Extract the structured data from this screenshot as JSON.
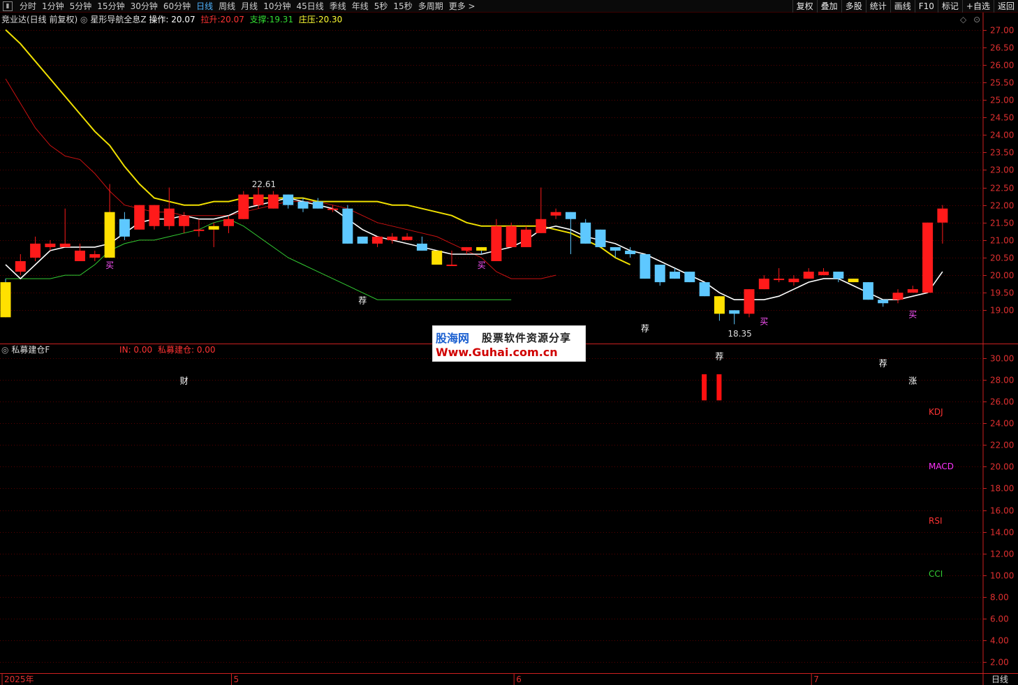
{
  "toolbar": {
    "periods": [
      {
        "label": "分时",
        "active": false
      },
      {
        "label": "1分钟",
        "active": false
      },
      {
        "label": "5分钟",
        "active": false
      },
      {
        "label": "15分钟",
        "active": false
      },
      {
        "label": "30分钟",
        "active": false
      },
      {
        "label": "60分钟",
        "active": false
      },
      {
        "label": "日线",
        "active": true
      },
      {
        "label": "周线",
        "active": false
      },
      {
        "label": "月线",
        "active": false
      },
      {
        "label": "10分钟",
        "active": false
      },
      {
        "label": "45日线",
        "active": false
      },
      {
        "label": "季线",
        "active": false
      },
      {
        "label": "年线",
        "active": false
      },
      {
        "label": "5秒",
        "active": false
      },
      {
        "label": "15秒",
        "active": false
      },
      {
        "label": "多周期",
        "active": false
      },
      {
        "label": "更多 >",
        "active": false
      }
    ],
    "right": [
      "复权",
      "叠加",
      "多股",
      "统计",
      "画线",
      "F10",
      "标记",
      "+自选",
      "返回"
    ]
  },
  "main_info": {
    "stock": "竞业达(日线 前复权)",
    "indicator": "星形导航全息Z",
    "op_label": "操作: 20.07",
    "pull_label": "拉升:",
    "pull_value": "20.07",
    "support_label": "支撑:",
    "support_value": "19.31",
    "press_label": "庄压:",
    "press_value": "20.30"
  },
  "sub_info": {
    "name": "私募建仓F",
    "in_label": "IN: 0.00",
    "pm_label": "私募建仓: 0.00"
  },
  "watermark": {
    "line1": "股海网",
    "line2": "股票软件资源分享",
    "line3": "Www.Guhai.com.cn"
  },
  "colors": {
    "up": "#ff1a1a",
    "down": "#5ec8ff",
    "ma_white": "#ffffff",
    "ma_yellow": "#f0e000",
    "ma_red": "#cc1111",
    "ma_green": "#33cc33",
    "grid": "#5a0000",
    "axis": "#cc2020"
  },
  "chart_data": [
    {
      "type": "candlestick",
      "y_ticks": [
        27.0,
        26.5,
        26.0,
        25.5,
        25.0,
        24.5,
        24.0,
        23.5,
        23.0,
        22.5,
        22.0,
        21.5,
        21.0,
        20.5,
        20.0,
        19.5,
        19.0
      ],
      "ylim": [
        18.05,
        27.45
      ],
      "x_labels": [
        {
          "label": "2025年",
          "index": 0
        },
        {
          "label": "5",
          "index": 15
        },
        {
          "label": "6",
          "index": 34
        },
        {
          "label": "7",
          "index": 54
        }
      ],
      "candles": [
        [
          19.8,
          18.8,
          19.9,
          18.8
        ],
        [
          20.1,
          20.4,
          20.6,
          20.0
        ],
        [
          20.5,
          20.9,
          21.1,
          20.4
        ],
        [
          20.8,
          20.9,
          21.0,
          20.7
        ],
        [
          20.8,
          20.9,
          21.9,
          20.8
        ],
        [
          20.4,
          20.7,
          20.9,
          20.4
        ],
        [
          20.5,
          20.6,
          20.7,
          20.4
        ],
        [
          20.5,
          21.8,
          22.6,
          20.5
        ],
        [
          21.6,
          21.1,
          21.8,
          21.0
        ],
        [
          21.3,
          22.0,
          22.0,
          21.3
        ],
        [
          21.4,
          22.0,
          22.0,
          21.3
        ],
        [
          21.4,
          21.9,
          22.5,
          21.3
        ],
        [
          21.4,
          21.7,
          21.8,
          21.2
        ],
        [
          21.3,
          21.3,
          21.6,
          21.1
        ],
        [
          21.3,
          21.4,
          21.5,
          20.8
        ],
        [
          21.4,
          21.6,
          21.7,
          21.2
        ],
        [
          21.6,
          22.3,
          22.4,
          21.6
        ],
        [
          22.0,
          22.3,
          22.5,
          21.9
        ],
        [
          21.9,
          22.3,
          22.4,
          21.9
        ],
        [
          22.3,
          22.0,
          22.3,
          21.9
        ],
        [
          22.1,
          21.9,
          22.2,
          21.8
        ],
        [
          22.1,
          21.9,
          22.2,
          21.9
        ],
        [
          21.9,
          21.9,
          22.0,
          21.8
        ],
        [
          21.9,
          20.9,
          22.0,
          20.9
        ],
        [
          21.1,
          20.9,
          21.1,
          20.9
        ],
        [
          20.9,
          21.1,
          21.1,
          20.8
        ],
        [
          21.0,
          21.1,
          21.2,
          20.9
        ],
        [
          21.0,
          21.1,
          21.2,
          21.0
        ],
        [
          20.9,
          20.7,
          21.1,
          20.7
        ],
        [
          20.7,
          20.3,
          20.7,
          20.3
        ],
        [
          20.3,
          20.3,
          20.7,
          20.3
        ],
        [
          20.7,
          20.8,
          20.8,
          20.6
        ],
        [
          20.8,
          20.7,
          20.8,
          20.6
        ],
        [
          20.4,
          21.4,
          21.6,
          20.4
        ],
        [
          20.8,
          21.4,
          21.5,
          20.8
        ],
        [
          20.8,
          21.3,
          21.4,
          20.8
        ],
        [
          21.2,
          21.6,
          22.5,
          21.2
        ],
        [
          21.7,
          21.8,
          21.9,
          21.6
        ],
        [
          21.8,
          21.6,
          21.8,
          20.6
        ],
        [
          21.5,
          20.9,
          21.6,
          20.9
        ],
        [
          21.3,
          20.8,
          21.3,
          20.8
        ],
        [
          20.8,
          20.7,
          20.8,
          20.5
        ],
        [
          20.7,
          20.6,
          20.8,
          20.5
        ],
        [
          20.6,
          19.9,
          20.6,
          19.9
        ],
        [
          20.3,
          19.8,
          20.3,
          19.7
        ],
        [
          20.1,
          19.9,
          20.2,
          19.9
        ],
        [
          20.1,
          19.8,
          20.1,
          19.8
        ],
        [
          19.8,
          19.4,
          19.8,
          19.4
        ],
        [
          19.4,
          18.9,
          19.4,
          18.7
        ],
        [
          19.0,
          18.9,
          19.0,
          18.6
        ],
        [
          18.9,
          19.6,
          19.6,
          18.8
        ],
        [
          19.6,
          19.9,
          20.0,
          19.6
        ],
        [
          19.9,
          19.9,
          20.2,
          19.8
        ],
        [
          19.8,
          19.9,
          20.0,
          19.7
        ],
        [
          19.9,
          20.1,
          20.2,
          19.9
        ],
        [
          20.0,
          20.1,
          20.2,
          20.0
        ],
        [
          20.1,
          19.9,
          20.1,
          19.8
        ],
        [
          19.9,
          19.8,
          19.9,
          19.8
        ],
        [
          19.8,
          19.3,
          19.8,
          19.3
        ],
        [
          19.3,
          19.2,
          19.3,
          19.1
        ],
        [
          19.3,
          19.5,
          19.6,
          19.2
        ],
        [
          19.5,
          19.6,
          19.7,
          19.5
        ],
        [
          19.5,
          21.5,
          21.5,
          19.5
        ],
        [
          21.5,
          21.9,
          22.0,
          20.9
        ]
      ],
      "yellow_bodies": [
        0,
        7,
        14,
        29,
        32,
        48,
        57
      ],
      "ma_white": [
        20.3,
        19.9,
        20.3,
        20.7,
        20.8,
        20.8,
        20.8,
        20.9,
        21.2,
        21.5,
        21.6,
        21.6,
        21.7,
        21.6,
        21.6,
        21.7,
        21.9,
        22.0,
        22.1,
        22.2,
        22.1,
        22.0,
        21.9,
        21.6,
        21.3,
        21.1,
        21.0,
        20.9,
        20.8,
        20.7,
        20.6,
        20.6,
        20.6,
        20.7,
        20.8,
        21.0,
        21.3,
        21.4,
        21.3,
        21.1,
        21.0,
        20.9,
        20.7,
        20.6,
        20.4,
        20.2,
        20.0,
        19.8,
        19.5,
        19.3,
        19.3,
        19.3,
        19.4,
        19.6,
        19.8,
        19.9,
        19.9,
        19.7,
        19.5,
        19.3,
        19.3,
        19.4,
        19.5,
        20.1
      ],
      "ma_yellow": [
        27.0,
        26.6,
        26.1,
        25.6,
        25.1,
        24.6,
        24.1,
        23.7,
        23.1,
        22.6,
        22.2,
        22.1,
        22.0,
        22.0,
        22.1,
        22.1,
        22.2,
        22.2,
        22.2,
        22.2,
        22.2,
        22.1,
        22.1,
        22.1,
        22.1,
        22.1,
        22.0,
        22.0,
        21.9,
        21.8,
        21.7,
        21.5,
        21.4,
        21.4,
        21.4,
        21.4,
        21.4,
        21.3,
        21.2,
        21.0,
        20.8,
        20.5,
        20.3
      ],
      "ma_yellow_start": 0,
      "ma_red": [
        25.6,
        24.9,
        24.2,
        23.7,
        23.4,
        23.3,
        22.9,
        22.4,
        22.0,
        21.9,
        21.8,
        21.8,
        21.7,
        21.7,
        21.7,
        21.7,
        21.8,
        21.9,
        22.0,
        22.1,
        22.1,
        22.1,
        22.0,
        21.9,
        21.7,
        21.5,
        21.4,
        21.3,
        21.2,
        21.1,
        20.9,
        20.7,
        20.5,
        20.1,
        19.9,
        19.9,
        19.9,
        20.0
      ],
      "ma_green": [
        19.9,
        19.9,
        19.9,
        19.9,
        20.0,
        20.0,
        20.3,
        20.7,
        20.9,
        21.0,
        21.0,
        21.1,
        21.2,
        21.3,
        21.5,
        21.6,
        21.4,
        21.1,
        20.8,
        20.5,
        20.3,
        20.1,
        19.9,
        19.7,
        19.5,
        19.3,
        19.3,
        19.3,
        19.3,
        19.3,
        19.3,
        19.3,
        19.3,
        19.3,
        19.3
      ],
      "annotations": [
        {
          "text": "22.61",
          "index": 16,
          "value": 22.61
        },
        {
          "text": "18.35",
          "index": 48,
          "value": 18.35
        }
      ],
      "signals": [
        {
          "text": "买",
          "index": 7,
          "value": 20.2,
          "color": "#ff55ff"
        },
        {
          "text": "荐",
          "index": 24,
          "value": 19.2,
          "color": "#ffffff"
        },
        {
          "text": "买",
          "index": 32,
          "value": 20.2,
          "color": "#ff55ff"
        },
        {
          "text": "荐",
          "index": 43,
          "value": 18.4,
          "color": "#ffffff"
        },
        {
          "text": "荐",
          "index": 48,
          "value": 17.6,
          "color": "#ffffff"
        },
        {
          "text": "买",
          "index": 51,
          "value": 18.6,
          "color": "#ff55ff"
        },
        {
          "text": "荐",
          "index": 59,
          "value": 17.4,
          "color": "#ffffff"
        },
        {
          "text": "买",
          "index": 61,
          "value": 18.8,
          "color": "#ff55ff"
        },
        {
          "text": "财",
          "index": 12,
          "value": 16.9,
          "color": "#ffffff"
        },
        {
          "text": "涨",
          "index": 61,
          "value": 16.9,
          "color": "#ffffff"
        }
      ]
    },
    {
      "type": "bar",
      "y_ticks": [
        30.0,
        28.0,
        26.0,
        24.0,
        22.0,
        20.0,
        18.0,
        16.0,
        14.0,
        12.0,
        10.0,
        8.0,
        6.0,
        4.0,
        2.0
      ],
      "ylim": [
        1.0,
        31.2
      ],
      "bars": [
        {
          "index": 47,
          "value": 28.5
        },
        {
          "index": 48,
          "value": 28.5
        }
      ],
      "legend": [
        {
          "label": "KDJ",
          "color": "#ff3333"
        },
        {
          "label": "MACD",
          "color": "#ff33ff"
        },
        {
          "label": "RSI",
          "color": "#ff3333"
        },
        {
          "label": "CCI",
          "color": "#33cc33"
        }
      ]
    }
  ],
  "bottom_right": "日线"
}
